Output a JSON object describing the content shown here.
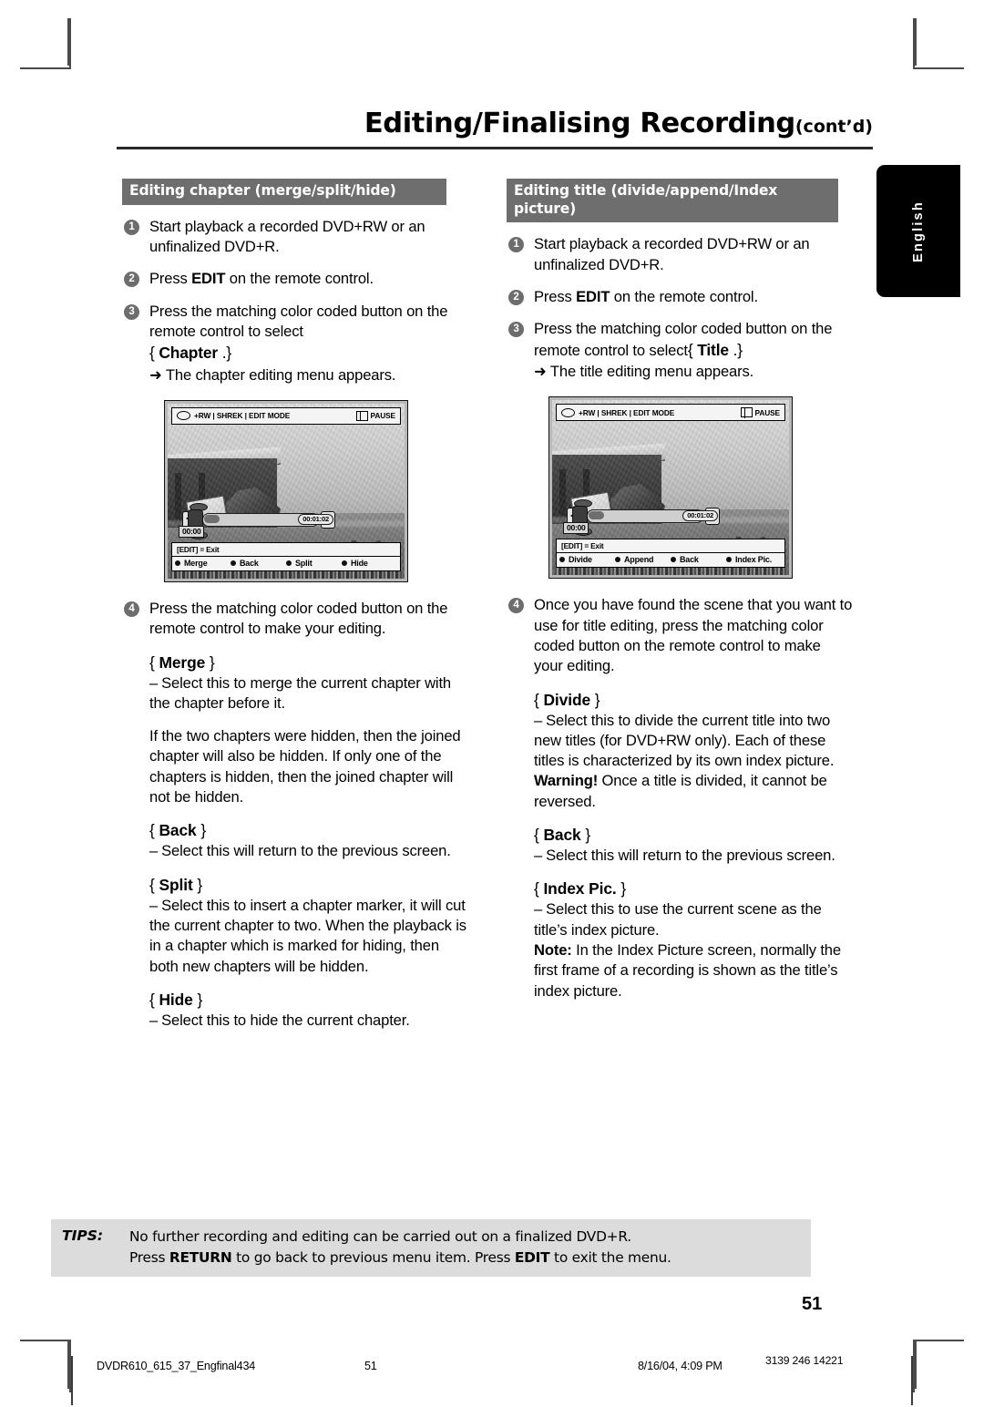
{
  "header": {
    "title": "Editing/Finalising Recording",
    "title_suffix": "(cont’d)"
  },
  "lang_tab": {
    "label": "English"
  },
  "columns": {
    "left": {
      "section_title": "Editing chapter (merge/split/hide)",
      "steps": [
        {
          "num": "1",
          "text": "Start playback a recorded DVD+RW or an unfinalized DVD+R."
        },
        {
          "num": "2",
          "text_before": "Press ",
          "bold": "EDIT",
          "text_after": " on the remote control."
        },
        {
          "num": "3",
          "text_before": "Press the matching color coded button on the remote control to select",
          "brace_open": "{ ",
          "brace_bold": "Chapter",
          "brace_close": " .}",
          "arrow": "➜ The chapter editing menu appears."
        }
      ],
      "step4": {
        "num": "4",
        "text": "Press the matching color coded button on the remote control to make your editing."
      },
      "blocks": [
        {
          "brace_open": "{ ",
          "brace_bold": "Merge",
          "brace_close": " }",
          "dash": "–",
          "dash_text": "Select this to merge the current chapter with the chapter before it."
        },
        {
          "brace_open": "{ ",
          "brace_bold": "Back",
          "brace_close": " }",
          "dash": "–",
          "dash_text": "Select this will return to the previous screen."
        },
        {
          "brace_open": "{ ",
          "brace_bold": "Split",
          "brace_close": " }",
          "dash": "–",
          "dash_text": "Select this to insert a chapter marker, it will cut the current chapter to two. When the playback is in a chapter which is marked for hiding, then both new chapters will be hidden."
        },
        {
          "brace_open": "{ ",
          "brace_bold": "Hide",
          "brace_close": " }",
          "dash": "–",
          "dash_text": "Select this to hide the current chapter."
        }
      ],
      "merge_note": "If the two chapters were hidden, then the joined chapter will also be hidden.  If only one of the chapters is hidden, then the joined chapter will not be hidden."
    },
    "right": {
      "section_title": "Editing title (divide/append/Index picture)",
      "steps": [
        {
          "num": "1",
          "text": "Start playback a recorded DVD+RW or an unfinalized DVD+R."
        },
        {
          "num": "2",
          "text_before": "Press ",
          "bold": "EDIT",
          "text_after": " on the remote control."
        },
        {
          "num": "3",
          "text_before": "Press the matching color coded button on the remote control to select",
          "brace_open": "{ ",
          "brace_bold": "Title",
          "brace_close": " .}",
          "arrow": "➜ The title editing menu appears."
        }
      ],
      "step4": {
        "num": "4",
        "text": "Once you have found the scene that you want to use for title editing, press the matching color coded button on the remote control to make your editing."
      },
      "blocks": [
        {
          "brace_open": "{ ",
          "brace_bold": "Divide",
          "brace_close": " }",
          "dash": "–",
          "dash_text": "Select this to divide the current title into two new titles (for DVD+RW only). Each of these titles is characterized by its own index picture.",
          "note_bold": "Warning!",
          "note_text": " Once a title is divided, it cannot be reversed."
        },
        {
          "brace_open": "{ ",
          "brace_bold": "Back",
          "brace_close": " }",
          "dash": "–",
          "dash_text": "Select this will return to the previous screen."
        },
        {
          "brace_open": "{ ",
          "brace_bold": "Index Pic.",
          "brace_close": " }",
          "dash": "–",
          "dash_text": "Select this to use the current scene as the title’s index picture.",
          "note_bold": "Note:",
          "note_text": " In the Index Picture screen, normally the first frame of a recording is shown as the title’s index picture."
        }
      ]
    }
  },
  "tv_left": {
    "status_disc": "+RW | SHREK | EDIT MODE",
    "status_mode": "PAUSE",
    "time_start": "00:00",
    "time_current": "00:01:02",
    "exit_hint": "[EDIT] = Exit",
    "options": [
      "Merge",
      "Back",
      "Split",
      "Hide"
    ]
  },
  "tv_right": {
    "status_disc": "+RW | SHREK | EDIT MODE",
    "status_mode": "PAUSE",
    "time_start": "00:00",
    "time_current": "00:01:02",
    "exit_hint": "[EDIT] = Exit",
    "options": [
      "Divide",
      "Append",
      "Back",
      "Index Pic."
    ]
  },
  "tips": {
    "label": "TIPS:",
    "line1": "No further recording and editing can be carried out on a finalized DVD+R.",
    "line2_a": "Press ",
    "line2_b": "RETURN",
    "line2_c": " to go back to previous menu item.  Press ",
    "line2_d": "EDIT",
    "line2_e": " to exit the menu."
  },
  "page_number": "51",
  "footer": {
    "file": "DVDR610_615_37_Engfinal434",
    "page": "51",
    "date": "8/16/04, 4:09 PM",
    "code": "3139 246 14221"
  }
}
